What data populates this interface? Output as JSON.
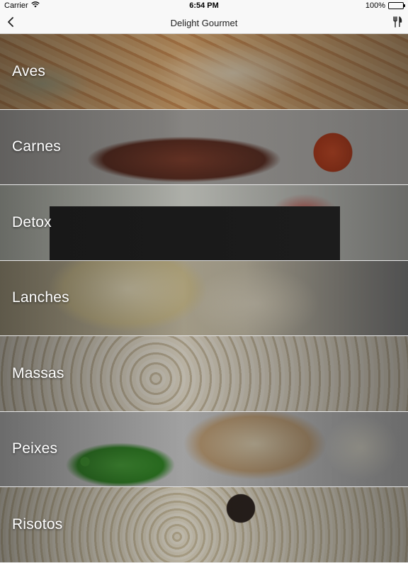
{
  "status_bar": {
    "carrier": "Carrier",
    "time": "6:54 PM",
    "battery": "100%"
  },
  "nav": {
    "title": "Delight Gourmet",
    "back_icon": "chevron-left-icon",
    "right_icon": "fork-knife-icon"
  },
  "categories": [
    {
      "label": "Aves"
    },
    {
      "label": "Carnes"
    },
    {
      "label": "Detox"
    },
    {
      "label": "Lanches"
    },
    {
      "label": "Massas"
    },
    {
      "label": "Peixes"
    },
    {
      "label": "Risotos"
    }
  ]
}
